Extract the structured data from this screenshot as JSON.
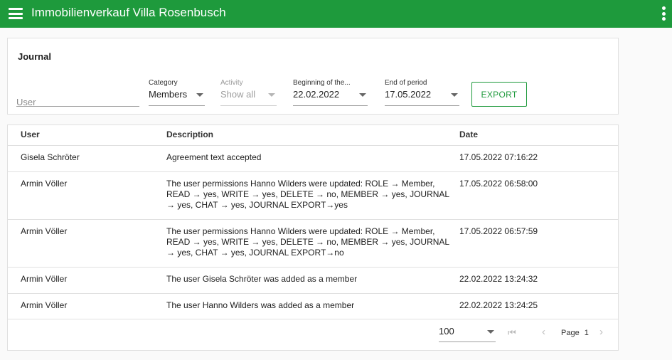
{
  "app": {
    "title": "Immobilienverkauf Villa Rosenbusch"
  },
  "filters": {
    "card_title": "Journal",
    "user": {
      "placeholder": "User"
    },
    "category": {
      "label": "Category",
      "value": "Members"
    },
    "activity": {
      "label": "Activity",
      "value": "Show all"
    },
    "beginning": {
      "label": "Beginning of the...",
      "value": "22.02.2022"
    },
    "end": {
      "label": "End of period",
      "value": "17.05.2022"
    },
    "export_label": "EXPORT"
  },
  "table": {
    "headers": {
      "user": "User",
      "description": "Description",
      "date": "Date"
    },
    "rows": [
      {
        "user": "Gisela Schröter",
        "description": "Agreement text accepted",
        "date": "17.05.2022 07:16:22"
      },
      {
        "user": "Armin Völler",
        "description": "The user permissions Hanno Wilders were updated: ROLE → Member, READ → yes, WRITE → yes, DELETE → no, MEMBER → yes, JOURNAL → yes, CHAT → yes, JOURNAL EXPORT→yes",
        "date": "17.05.2022 06:58:00"
      },
      {
        "user": "Armin Völler",
        "description": "The user permissions Hanno Wilders were updated: ROLE → Member, READ → yes, WRITE → yes, DELETE → no, MEMBER → yes, JOURNAL → yes, CHAT → yes, JOURNAL EXPORT→no",
        "date": "17.05.2022 06:57:59"
      },
      {
        "user": "Armin Völler",
        "description": "The user Gisela Schröter was added as a member",
        "date": "22.02.2022 13:24:32"
      },
      {
        "user": "Armin Völler",
        "description": "The user Hanno Wilders was added as a member",
        "date": "22.02.2022 13:24:25"
      }
    ]
  },
  "pager": {
    "page_size": "100",
    "page_label": "Page",
    "page_number": "1"
  },
  "colors": {
    "brand": "#1e9a3c"
  },
  "icons": {
    "menu": "menu-icon",
    "more": "more-vert-icon",
    "first": "first-page-icon",
    "prev": "chevron-left-icon",
    "next": "chevron-right-icon"
  }
}
